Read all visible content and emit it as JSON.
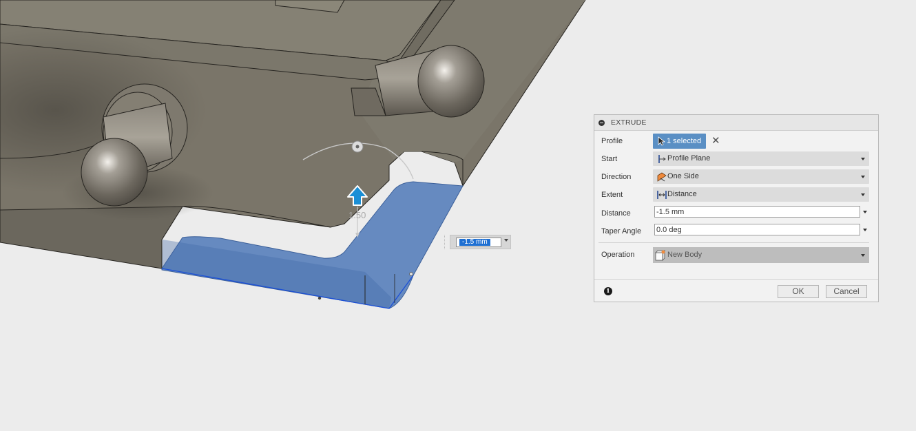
{
  "viewport": {
    "dimension_label": "1.50",
    "ondrag_value": "-1.5 mm"
  },
  "dialog": {
    "title": "EXTRUDE",
    "rows": {
      "profile": {
        "label": "Profile",
        "value": "1 selected",
        "clear": "✕"
      },
      "start": {
        "label": "Start",
        "value": "Profile Plane"
      },
      "direction": {
        "label": "Direction",
        "value": "One Side"
      },
      "extent": {
        "label": "Extent",
        "value": "Distance"
      },
      "distance": {
        "label": "Distance",
        "value": "-1.5 mm"
      },
      "taper": {
        "label": "Taper Angle",
        "value": "0.0 deg"
      },
      "operation": {
        "label": "Operation",
        "value": "New Body"
      }
    },
    "info": "i",
    "ok_label": "OK",
    "cancel_label": "Cancel"
  },
  "colors": {
    "background": "#ececec",
    "model_gray": "#7a7569",
    "preview_blue": "#4f79b8",
    "selection_blue": "#5a8fc4",
    "manipulator_blue": "#1a8fd6"
  }
}
